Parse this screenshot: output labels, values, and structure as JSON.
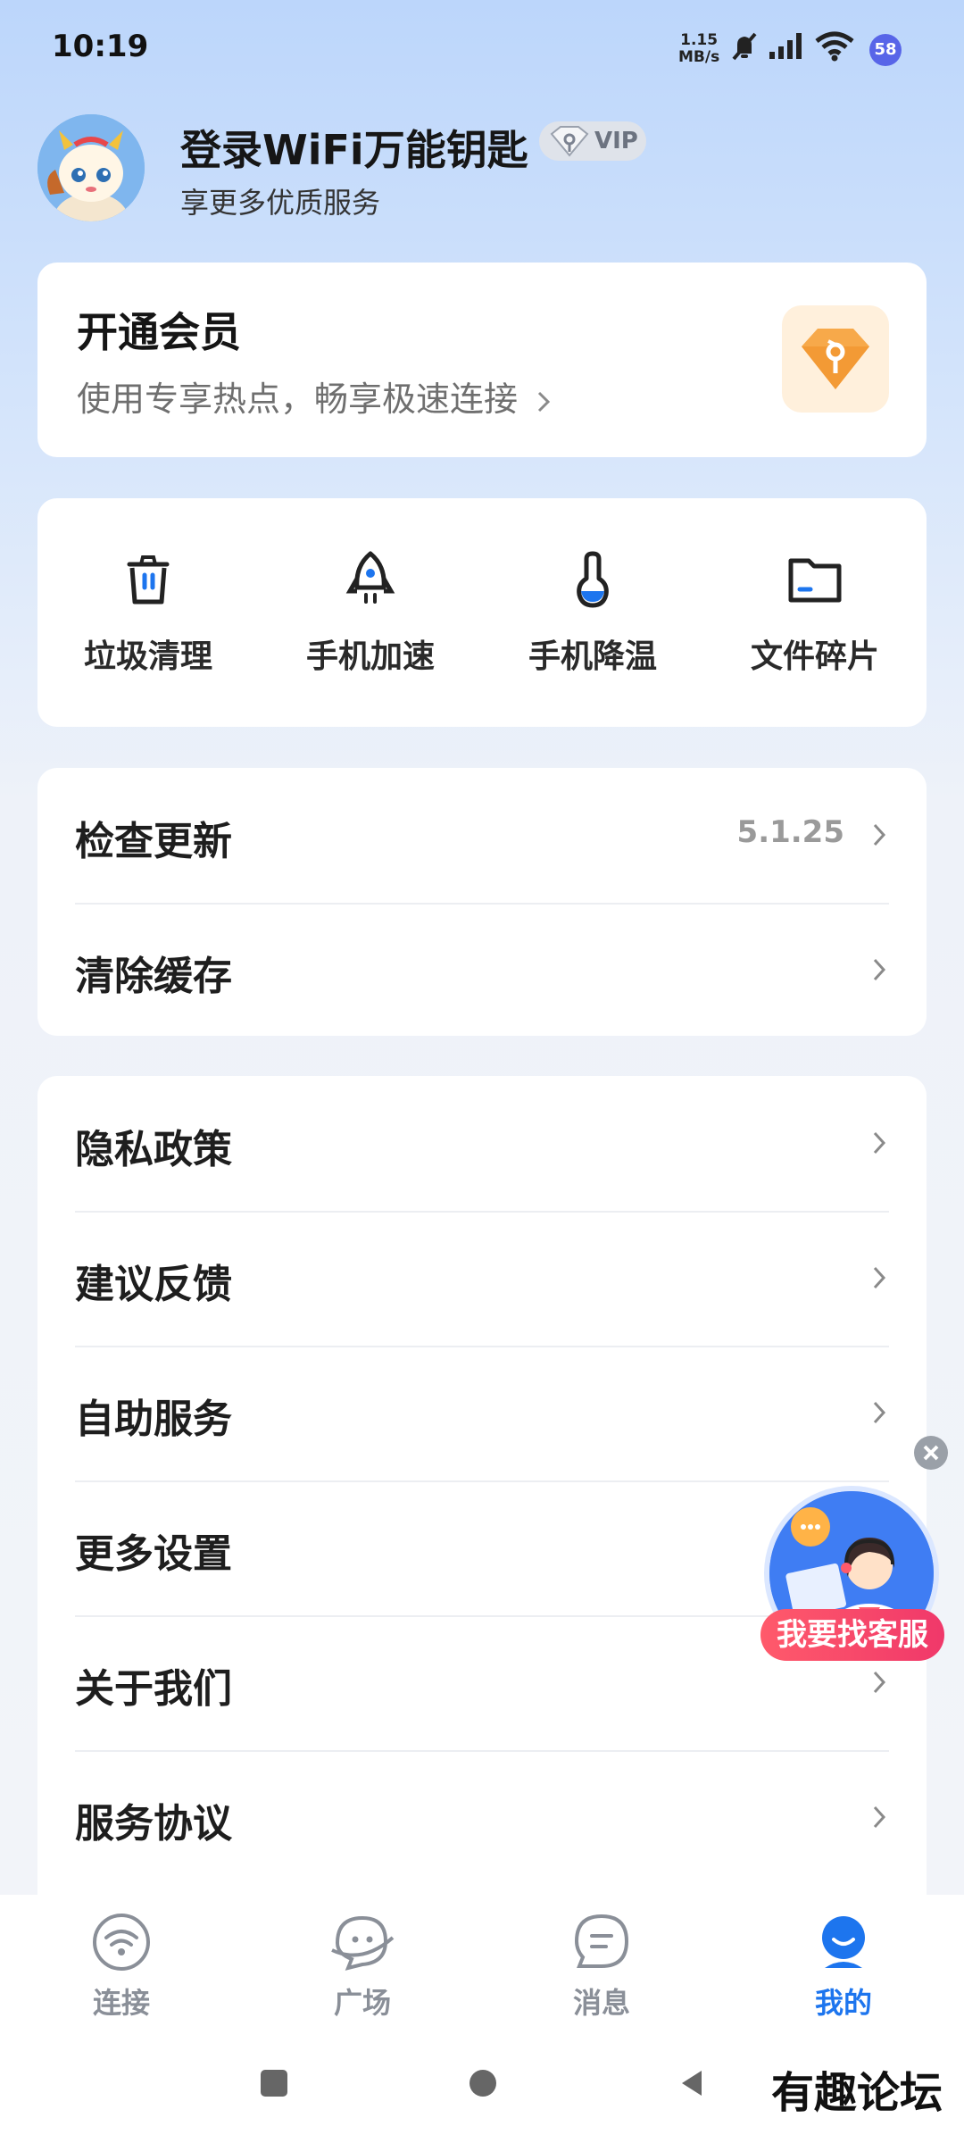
{
  "status_bar": {
    "time": "10:19",
    "speed_value": "1.15",
    "speed_unit": "MB/s",
    "battery": "58",
    "icons": [
      "mute-icon",
      "signal-icon",
      "wifi-icon"
    ]
  },
  "profile": {
    "title": "登录WiFi万能钥匙",
    "vip_badge": "VIP",
    "subtitle": "享更多优质服务"
  },
  "vip_card": {
    "title": "开通会员",
    "subtitle": "使用专享热点，畅享极速连接"
  },
  "tools": [
    {
      "label": "垃圾清理",
      "icon": "trash-icon"
    },
    {
      "label": "手机加速",
      "icon": "rocket-icon"
    },
    {
      "label": "手机降温",
      "icon": "thermometer-icon"
    },
    {
      "label": "文件碎片",
      "icon": "folder-icon"
    }
  ],
  "settings_group1": [
    {
      "label": "检查更新",
      "value": "5.1.25"
    },
    {
      "label": "清除缓存",
      "value": ""
    }
  ],
  "settings_group2": [
    {
      "label": "隐私政策"
    },
    {
      "label": "建议反馈"
    },
    {
      "label": "自助服务"
    },
    {
      "label": "更多设置"
    },
    {
      "label": "关于我们"
    },
    {
      "label": "服务协议"
    }
  ],
  "floating_service": {
    "label": "我要找客服"
  },
  "bottom_nav": [
    {
      "label": "连接",
      "icon": "wifi-icon",
      "active": false
    },
    {
      "label": "广场",
      "icon": "chat-bubble-icon",
      "active": false
    },
    {
      "label": "消息",
      "icon": "message-icon",
      "active": false
    },
    {
      "label": "我的",
      "icon": "profile-icon",
      "active": true
    }
  ],
  "colors": {
    "accent": "#1d75ee",
    "cs_label": "#f0386a",
    "vip_gem": "#f7a94a"
  },
  "watermark": "有趣论坛"
}
